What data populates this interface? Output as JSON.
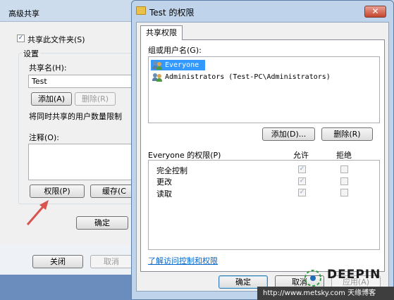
{
  "bg_dialog": {
    "title": "高级共享",
    "share_checkbox_label": "共享此文件夹(S)",
    "settings_group_label": "设置",
    "share_name_label": "共享名(H):",
    "share_name_value": "Test",
    "add_label": "添加(A)",
    "remove_label": "删除(R)",
    "limit_text": "将同时共享的用户数量限制",
    "comment_label": "注释(O):",
    "permissions_label": "权限(P)",
    "cache_label": "缓存(C",
    "ok_label": "确定",
    "close_label": "关闭",
    "cancel_label": "取消"
  },
  "fg_dialog": {
    "title": "Test 的权限",
    "close_glyph": "✕",
    "tab_label": "共享权限",
    "group_label": "组或用户名(G):",
    "users": [
      {
        "name": "Everyone",
        "selected": true
      },
      {
        "name": "Administrators (Test-PC\\Administrators)",
        "selected": false
      }
    ],
    "add_label": "添加(D)...",
    "remove_label": "删除(R)",
    "perm_header": "Everyone 的权限(P)",
    "allow_header": "允许",
    "deny_header": "拒绝",
    "permissions": [
      {
        "name": "完全控制",
        "allow": true,
        "deny": false
      },
      {
        "name": "更改",
        "allow": true,
        "deny": false
      },
      {
        "name": "读取",
        "allow": true,
        "deny": false
      }
    ],
    "link_text": "了解访问控制和权限",
    "ok_label": "确定",
    "cancel_label": "取消",
    "apply_label": "应用(A)"
  },
  "watermark": {
    "brand": "DEEPIN",
    "url_text": "http://www.metsky.com 天缘博客"
  },
  "colors": {
    "selection": "#3399ff",
    "arrow": "#d9534f",
    "link": "#0066cc"
  }
}
